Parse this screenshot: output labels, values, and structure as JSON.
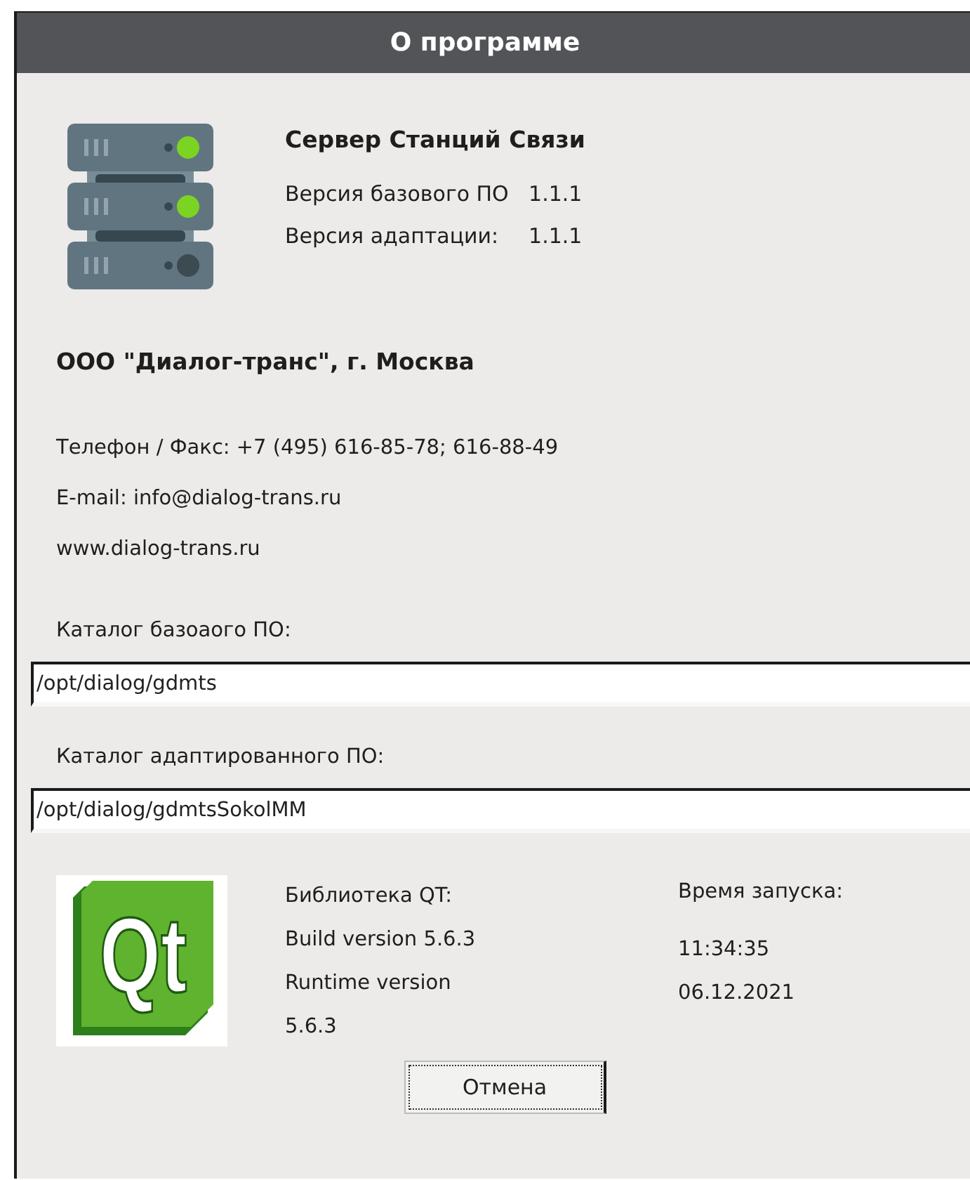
{
  "window": {
    "title": "О программе"
  },
  "product": {
    "name": "Сервер Станций Связи",
    "versions": [
      {
        "label": "Версия базового ПО",
        "value": "1.1.1"
      },
      {
        "label": "Версия адаптации:",
        "value": "1.1.1"
      }
    ]
  },
  "company": "ООО \"Диалог-транс\", г. Москва",
  "contacts": [
    "Телефон / Факс: +7 (495) 616-85-78; 616-88-49",
    "E-mail: info@dialog-trans.ru",
    "www.dialog-trans.ru"
  ],
  "paths": [
    {
      "label": "Каталог базоаого ПО:",
      "value": "/opt/dialog/gdmts"
    },
    {
      "label": "Каталог адаптированного ПО:",
      "value": "/opt/dialog/gdmtsSokolMM"
    }
  ],
  "qt": {
    "logo_text": "Qt",
    "lines": [
      "Библиотека QT:",
      "Build version 5.6.3",
      "Runtime version",
      "5.6.3"
    ]
  },
  "launch": {
    "label": "Время запуска:",
    "time": "11:34:35",
    "date": "06.12.2021"
  },
  "buttons": [
    {
      "label": "Отмена",
      "focused": true
    }
  ]
}
